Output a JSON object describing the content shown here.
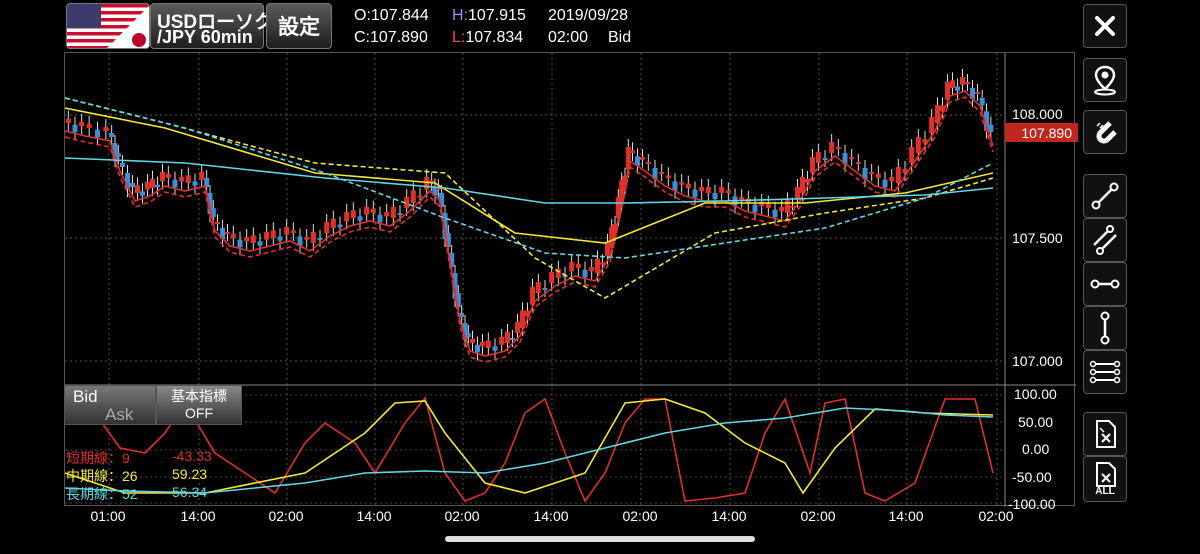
{
  "header": {
    "symbol_top": "USDローソク",
    "symbol_bottom": "/JPY 60min",
    "settings_label": "設定",
    "o_label": "O:",
    "o_value": "107.844",
    "h_label": "H:",
    "h_value": "107.915",
    "date": "2019/09/28",
    "c_label": "C:",
    "c_value": "107.890",
    "l_label": "L:",
    "l_value": "107.834",
    "time": "02:00",
    "price_type": "Bid"
  },
  "price_axis": [
    "108.000",
    "107.500",
    "107.000"
  ],
  "current_price": "107.890",
  "osc_axis": [
    "100.00",
    "50.00",
    "0.00",
    "-50.00",
    "-100.00"
  ],
  "time_axis": [
    "01:00",
    "14:00",
    "02:00",
    "14:00",
    "02:00",
    "14:00",
    "02:00",
    "14:00",
    "02:00",
    "14:00",
    "02:00"
  ],
  "bid_label": "Bid",
  "ask_label": "Ask",
  "tech_button": {
    "line1": "基本指標",
    "line2": "OFF"
  },
  "legend": [
    {
      "label": "短期線：9",
      "value": "-43.33",
      "color": "#e0302a"
    },
    {
      "label": "中期線：26",
      "value": "59.23",
      "color": "#f2e83a"
    },
    {
      "label": "長期線：52",
      "value": "56.34",
      "color": "#5fd8e6"
    }
  ],
  "sidebar": [
    "close-icon",
    "location-pin-icon",
    "magnet-icon",
    "trendline-icon",
    "parallel-lines-icon",
    "horizontal-line-icon",
    "vertical-line-icon",
    "multi-lines-icon",
    "delete-icon",
    "delete-all-icon"
  ],
  "delete_all_label": "ALL",
  "colors": {
    "up": "#e0302a",
    "down": "#3a8fd8",
    "short": "#e0302a",
    "mid": "#f2e83a",
    "long": "#5fd8e6",
    "price_badge": "#c0271e"
  }
}
